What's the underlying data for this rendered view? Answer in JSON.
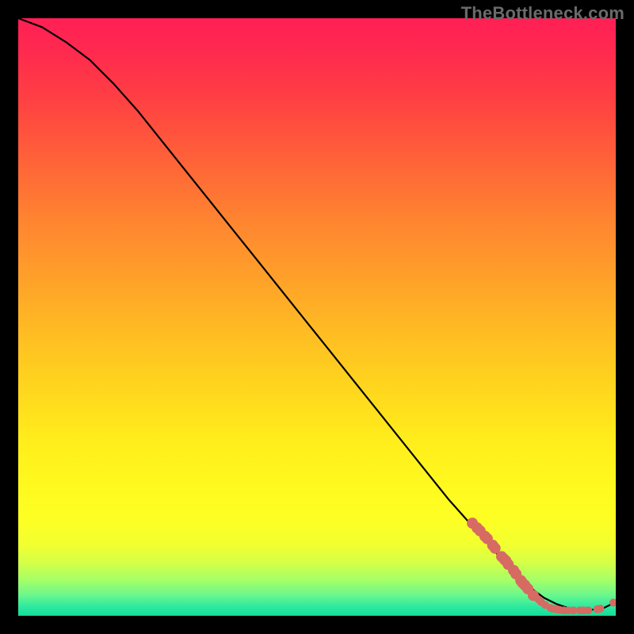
{
  "watermark": "TheBottleneck.com",
  "chart_data": {
    "type": "line",
    "title": "",
    "xlabel": "",
    "ylabel": "",
    "xlim": [
      0,
      100
    ],
    "ylim": [
      0,
      100
    ],
    "grid": false,
    "legend": false,
    "series": [
      {
        "name": "curve",
        "x": [
          0,
          4,
          8,
          12,
          16,
          20,
          24,
          28,
          32,
          36,
          40,
          44,
          48,
          52,
          56,
          60,
          64,
          68,
          72,
          76,
          80,
          84,
          86,
          88,
          90,
          92,
          94,
          96,
          98,
          100
        ],
        "y": [
          100,
          98.5,
          96,
          93,
          89,
          84.5,
          79.5,
          74.5,
          69.5,
          64.5,
          59.5,
          54.5,
          49.5,
          44.5,
          39.5,
          34.5,
          29.5,
          24.5,
          19.5,
          15,
          10.5,
          6.5,
          4.5,
          3,
          2,
          1.3,
          1,
          1,
          1.3,
          2.3
        ]
      }
    ],
    "highlight_points": {
      "name": "dots",
      "color": "#d66b63",
      "points": [
        [
          76,
          15.5
        ],
        [
          76.8,
          14.7
        ],
        [
          77.3,
          14.2
        ],
        [
          78.1,
          13.3
        ],
        [
          78.5,
          12.9
        ],
        [
          79.4,
          11.8
        ],
        [
          79.8,
          11.3
        ],
        [
          80.9,
          9.9
        ],
        [
          81.3,
          9.5
        ],
        [
          81.6,
          9.2
        ],
        [
          82,
          8.6
        ],
        [
          82.9,
          7.6
        ],
        [
          83.3,
          7.0
        ],
        [
          84.1,
          5.9
        ],
        [
          84.4,
          5.5
        ],
        [
          84.8,
          5.1
        ],
        [
          85.3,
          4.5
        ],
        [
          86.2,
          3.4
        ],
        [
          86.6,
          3.1
        ],
        [
          87.1,
          2.7
        ],
        [
          87.5,
          2.3
        ],
        [
          88.2,
          1.8
        ],
        [
          89.1,
          1.3
        ],
        [
          89.5,
          1.2
        ],
        [
          90.1,
          1.1
        ],
        [
          90.6,
          1.0
        ],
        [
          91.3,
          0.9
        ],
        [
          92.1,
          0.9
        ],
        [
          92.9,
          0.9
        ],
        [
          94.0,
          0.9
        ],
        [
          94.6,
          0.9
        ],
        [
          95.4,
          0.9
        ],
        [
          96.9,
          1.1
        ],
        [
          97.4,
          1.2
        ],
        [
          99.6,
          2.2
        ]
      ],
      "radius_small": 5,
      "radius_large": 7
    }
  }
}
